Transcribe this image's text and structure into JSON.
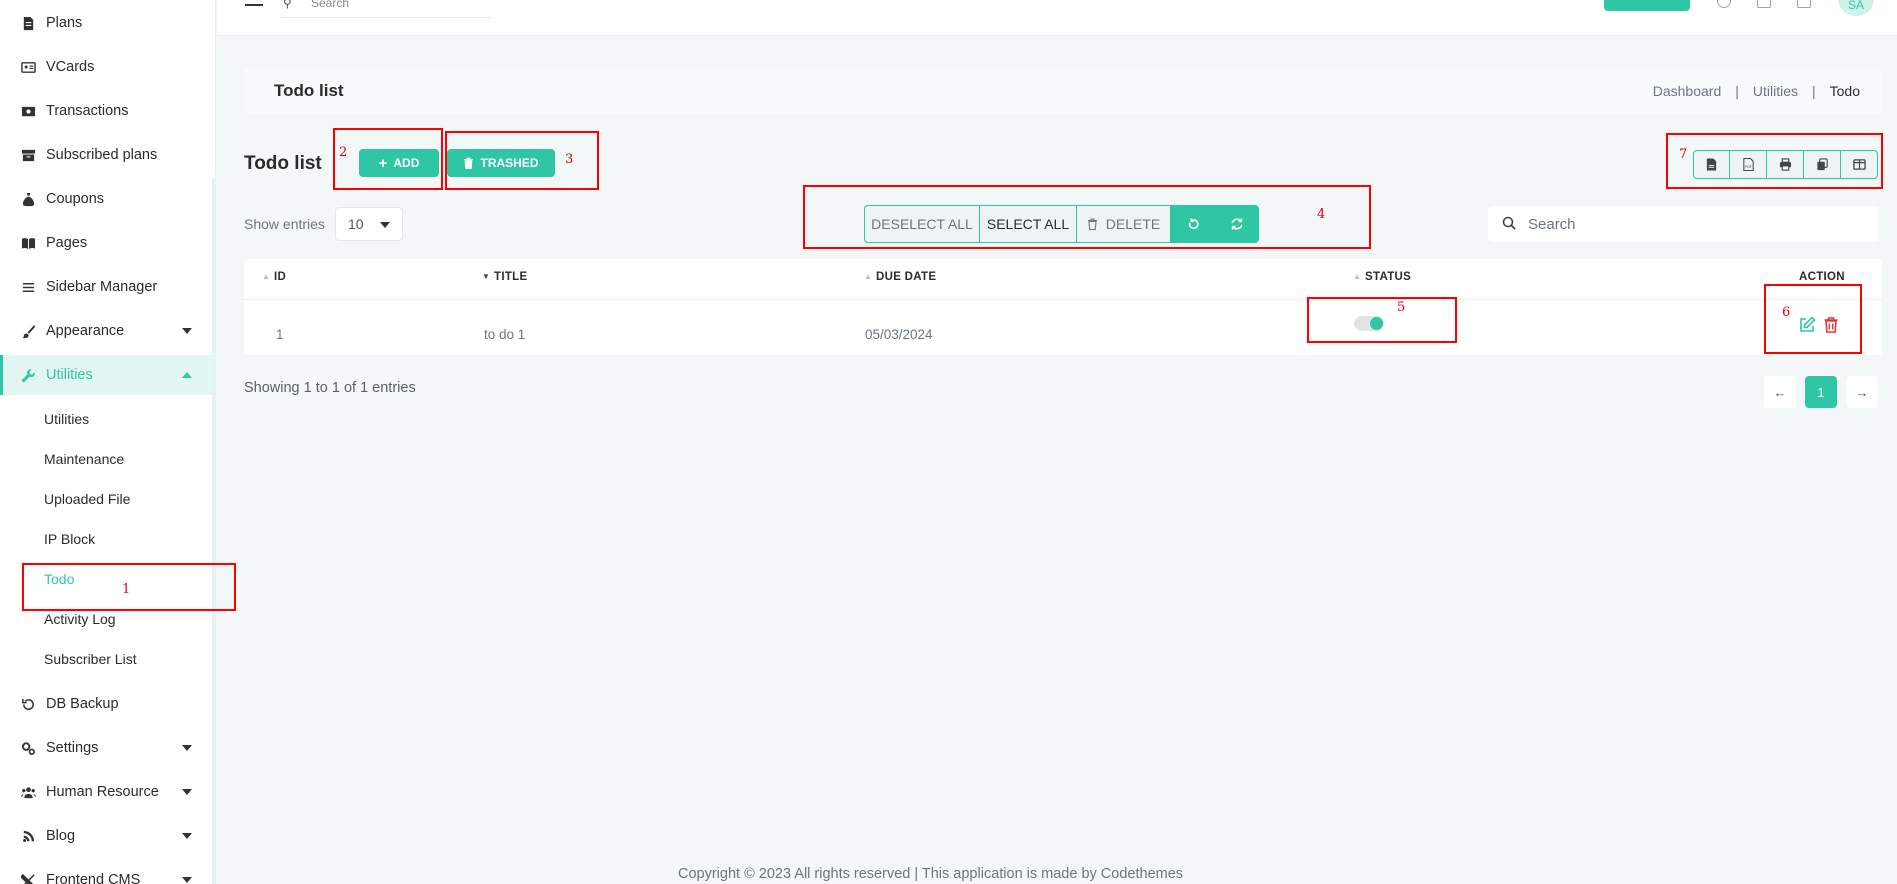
{
  "sidebar": {
    "items": [
      {
        "label": "Plans",
        "icon": "document-icon"
      },
      {
        "label": "VCards",
        "icon": "id-card-icon"
      },
      {
        "label": "Transactions",
        "icon": "money-icon"
      },
      {
        "label": "Subscribed plans",
        "icon": "archive-icon"
      },
      {
        "label": "Coupons",
        "icon": "money-bag-icon"
      },
      {
        "label": "Pages",
        "icon": "book-icon"
      },
      {
        "label": "Sidebar Manager",
        "icon": "bars-icon"
      },
      {
        "label": "Appearance",
        "icon": "brush-icon"
      },
      {
        "label": "Utilities",
        "icon": "wrench-icon"
      },
      {
        "label": "DB Backup",
        "icon": "history-icon"
      },
      {
        "label": "Settings",
        "icon": "gears-icon"
      },
      {
        "label": "Human Resource",
        "icon": "users-icon"
      },
      {
        "label": "Blog",
        "icon": "blog-icon"
      },
      {
        "label": "Frontend CMS",
        "icon": "tools-icon"
      }
    ],
    "utilities_sub": [
      "Utilities",
      "Maintenance",
      "Uploaded File",
      "IP Block",
      "Todo",
      "Activity Log",
      "Subscriber List"
    ]
  },
  "topbar": {
    "search_placeholder": "Search",
    "avatar_initials": "SA"
  },
  "header": {
    "title": "Todo list",
    "breadcrumb": [
      "Dashboard",
      "|",
      "Utilities",
      "|",
      "Todo"
    ]
  },
  "toolbar": {
    "title": "Todo list",
    "add_label": "ADD",
    "trashed_label": "TRASHED",
    "show_entries_label": "Show entries",
    "entries_value": "10",
    "deselect_all": "DESELECT ALL",
    "select_all": "SELECT ALL",
    "delete_label": "DELETE",
    "search_placeholder": "Search"
  },
  "annotations": [
    "1",
    "2",
    "3",
    "4",
    "5",
    "6",
    "7"
  ],
  "table": {
    "columns": [
      "ID",
      "TITLE",
      "DUE DATE",
      "STATUS",
      "ACTION"
    ],
    "rows": [
      {
        "id": "1",
        "title": "to do 1",
        "due_date": "05/03/2024",
        "status": "on"
      }
    ]
  },
  "pagination": {
    "info": "Showing 1 to 1 of 1 entries",
    "current": "1",
    "prev": "←",
    "next": "→"
  },
  "footer": {
    "text": "Copyright © 2023 All rights reserved | This application is made by Codethemes"
  },
  "colors": {
    "accent": "#2fc6a6",
    "danger": "#e53935",
    "annotation": "#ff0000"
  }
}
